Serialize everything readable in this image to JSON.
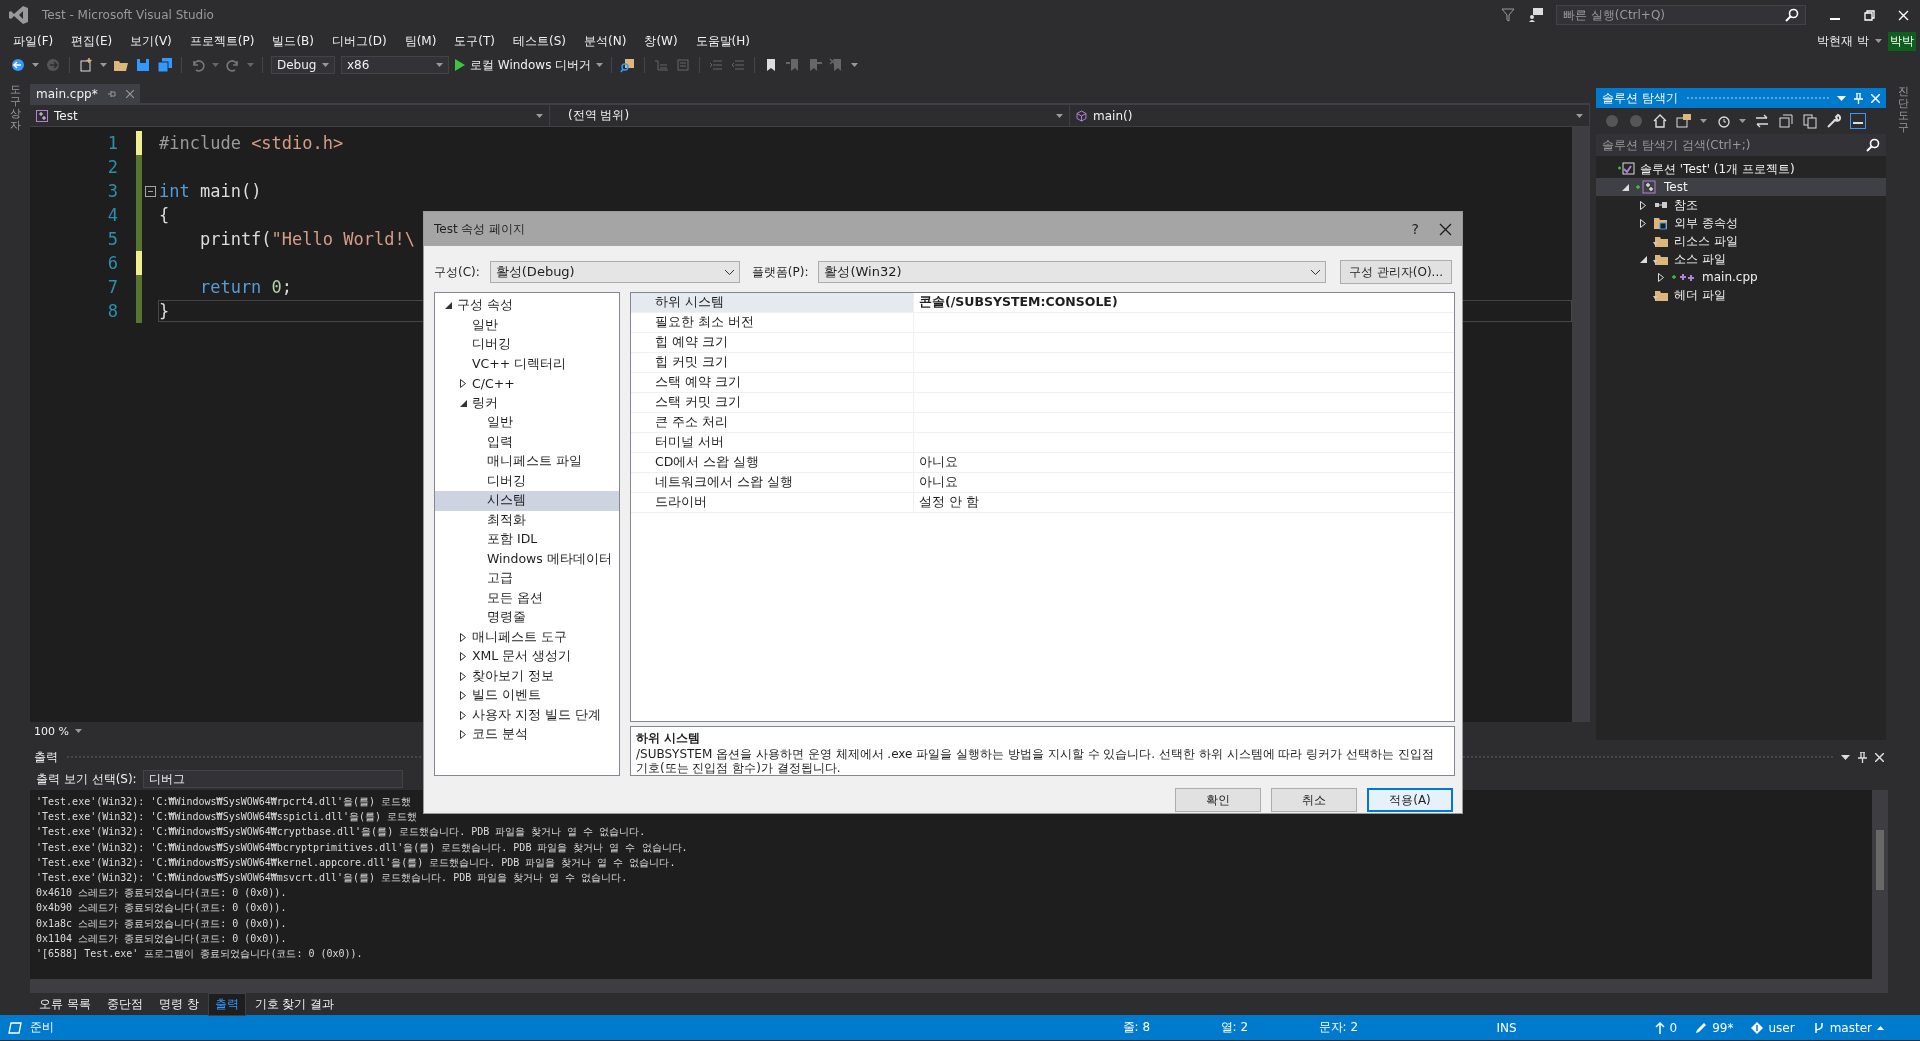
{
  "window": {
    "title": "Test - Microsoft Visual Studio"
  },
  "quick_launch": {
    "placeholder": "빠른 실행(Ctrl+Q)"
  },
  "menu": [
    "파일(F)",
    "편집(E)",
    "보기(V)",
    "프로젝트(P)",
    "빌드(B)",
    "디버그(D)",
    "팀(M)",
    "도구(T)",
    "테스트(S)",
    "분석(N)",
    "창(W)",
    "도움말(H)"
  ],
  "account": {
    "name": "박현재 박",
    "badge": "박박"
  },
  "toolbar": {
    "configuration": "Debug",
    "platform": "x86",
    "run": "로컬 Windows 디버거"
  },
  "left_strip": {
    "label": "도구 상자"
  },
  "right_strip": {
    "label": "진단 도구"
  },
  "editor": {
    "tab": {
      "label": "main.cpp*"
    },
    "nav": {
      "project": "Test",
      "scope": "(전역 범위)",
      "member": "main()"
    },
    "lines": [
      {
        "number": "1",
        "unsaved": true,
        "fold": false,
        "current": false,
        "tokens": [
          {
            "kind": "directive",
            "text": "#include"
          },
          {
            "kind": "string",
            "text": " <stdio.h>"
          }
        ]
      },
      {
        "number": "2",
        "unsaved": false,
        "fold": false,
        "current": false
      },
      {
        "number": "3",
        "unsaved": false,
        "fold": true,
        "current": false,
        "tokens": [
          {
            "kind": "keyword",
            "text": "int"
          },
          {
            "kind": "plain",
            "text": " main()"
          }
        ]
      },
      {
        "number": "4",
        "unsaved": false,
        "fold": false,
        "current": false,
        "tokens": [
          {
            "kind": "plain",
            "text": "{"
          }
        ]
      },
      {
        "number": "5",
        "unsaved": false,
        "fold": false,
        "current": false,
        "tokens": [
          {
            "kind": "plain",
            "text": "    printf("
          },
          {
            "kind": "string",
            "text": "\"Hello World!\\"
          }
        ]
      },
      {
        "number": "6",
        "unsaved": true,
        "fold": false,
        "current": false
      },
      {
        "number": "7",
        "unsaved": false,
        "fold": false,
        "current": false,
        "tokens": [
          {
            "kind": "keyword",
            "text": "    return"
          },
          {
            "kind": "number",
            "text": " 0"
          },
          {
            "kind": "plain",
            "text": ";"
          }
        ]
      },
      {
        "number": "8",
        "unsaved": false,
        "fold": false,
        "current": true,
        "tokens": [
          {
            "kind": "plain",
            "text": "}"
          }
        ]
      }
    ],
    "zoom": "100 %"
  },
  "solution_explorer": {
    "title": "솔루션 탐색기",
    "search": {
      "placeholder": "솔루션 탐색기 검색(Ctrl+;)"
    },
    "tree": [
      {
        "label": "솔루션 'Test' (1개 프로젝트)",
        "kind": "solution",
        "selected": false,
        "children": [
          {
            "label": "Test",
            "kind": "project",
            "expanded": true,
            "selected": true,
            "children": [
              {
                "label": "참조",
                "kind": "references",
                "expanded": false,
                "selected": false
              },
              {
                "label": "외부 종속성",
                "kind": "external",
                "expanded": false,
                "selected": false
              },
              {
                "label": "리소스 파일",
                "kind": "filter",
                "selected": false
              },
              {
                "label": "소스 파일",
                "kind": "filter",
                "expanded": true,
                "selected": false,
                "children": [
                  {
                    "label": "main.cpp",
                    "kind": "cpp",
                    "expanded": false,
                    "selected": false
                  }
                ]
              },
              {
                "label": "헤더 파일",
                "kind": "filter",
                "selected": false
              }
            ]
          }
        ]
      }
    ]
  },
  "output": {
    "title": "출력",
    "source_label": "출력 보기 선택(S):",
    "source": "디버그",
    "lines": [
      "'Test.exe'(Win32): 'C:₩Windows₩SysWOW64₩rpcrt4.dll'을(를) 로드했",
      "'Test.exe'(Win32): 'C:₩Windows₩SysWOW64₩sspicli.dll'을(를) 로드했",
      "'Test.exe'(Win32): 'C:₩Windows₩SysWOW64₩cryptbase.dll'을(를) 로드했습니다. PDB 파일을 찾거나 열 수 없습니다.",
      "'Test.exe'(Win32): 'C:₩Windows₩SysWOW64₩bcryptprimitives.dll'을(를) 로드했습니다. PDB 파일을 찾거나 열 수 없습니다.",
      "'Test.exe'(Win32): 'C:₩Windows₩SysWOW64₩kernel.appcore.dll'을(를) 로드했습니다. PDB 파일을 찾거나 열 수 없습니다.",
      "'Test.exe'(Win32): 'C:₩Windows₩SysWOW64₩msvcrt.dll'을(를) 로드했습니다. PDB 파일을 찾거나 열 수 없습니다.",
      "0x4610 스레드가 종료되었습니다(코드: 0 (0x0)).",
      "0x4b90 스레드가 종료되었습니다(코드: 0 (0x0)).",
      "0x1a8c 스레드가 종료되었습니다(코드: 0 (0x0)).",
      "0x1104 스레드가 종료되었습니다(코드: 0 (0x0)).",
      "'[6588] Test.exe' 프로그램이 종료되었습니다(코드: 0 (0x0))."
    ]
  },
  "bottom_tabs": [
    {
      "label": "오류 목록",
      "selected": false
    },
    {
      "label": "중단점",
      "selected": false
    },
    {
      "label": "명령 창",
      "selected": false
    },
    {
      "label": "출력",
      "selected": true
    },
    {
      "label": "기호 찾기 결과",
      "selected": false
    }
  ],
  "status_bar": {
    "state": "준비",
    "line": "줄: 8",
    "column": "열: 2",
    "char": "문자: 2",
    "mode": "INS",
    "up": "0",
    "pending": "99*",
    "user": "user",
    "branch": "master"
  },
  "dialog": {
    "title": "Test 속성 페이지",
    "help": "?",
    "config_label": "구성(C):",
    "config": "활성(Debug)",
    "platform_label": "플랫폼(P):",
    "platform": "활성(Win32)",
    "manager": "구성 관리자(O)...",
    "tree": [
      {
        "label": "구성 속성",
        "expanded": true,
        "selected": false,
        "children": [
          {
            "label": "일반",
            "selected": false
          },
          {
            "label": "디버깅",
            "selected": false
          },
          {
            "label": "VC++ 디렉터리",
            "selected": false
          },
          {
            "label": "C/C++",
            "expanded": false,
            "selected": false
          },
          {
            "label": "링커",
            "expanded": true,
            "selected": false,
            "children": [
              {
                "label": "일반",
                "selected": false
              },
              {
                "label": "입력",
                "selected": false
              },
              {
                "label": "매니페스트 파일",
                "selected": false
              },
              {
                "label": "디버깅",
                "selected": false
              },
              {
                "label": "시스템",
                "selected": true
              },
              {
                "label": "최적화",
                "selected": false
              },
              {
                "label": "포함 IDL",
                "selected": false
              },
              {
                "label": "Windows 메타데이터",
                "selected": false
              },
              {
                "label": "고급",
                "selected": false
              },
              {
                "label": "모든 옵션",
                "selected": false
              },
              {
                "label": "명령줄",
                "selected": false
              }
            ]
          },
          {
            "label": "매니페스트 도구",
            "expanded": false,
            "selected": false
          },
          {
            "label": "XML 문서 생성기",
            "expanded": false,
            "selected": false
          },
          {
            "label": "찾아보기 정보",
            "expanded": false,
            "selected": false
          },
          {
            "label": "빌드 이벤트",
            "expanded": false,
            "selected": false
          },
          {
            "label": "사용자 지정 빌드 단계",
            "expanded": false,
            "selected": false
          },
          {
            "label": "코드 분석",
            "expanded": false,
            "selected": false
          }
        ]
      }
    ],
    "properties": [
      {
        "name": "하위 시스템",
        "value": "콘솔(/SUBSYSTEM:CONSOLE)",
        "selected": true,
        "modified": true
      },
      {
        "name": "필요한 최소 버전",
        "selected": false
      },
      {
        "name": "힙 예약 크기",
        "selected": false
      },
      {
        "name": "힙 커밋 크기",
        "selected": false
      },
      {
        "name": "스택 예약 크기",
        "selected": false
      },
      {
        "name": "스택 커밋 크기",
        "selected": false
      },
      {
        "name": "큰 주소 처리",
        "selected": false
      },
      {
        "name": "터미널 서버",
        "selected": false
      },
      {
        "name": "CD에서 스왑 실행",
        "value": "아니요",
        "selected": false,
        "modified": false
      },
      {
        "name": "네트워크에서 스왑 실행",
        "value": "아니요",
        "selected": false,
        "modified": false
      },
      {
        "name": "드라이버",
        "value": "설정 안 함",
        "selected": false,
        "modified": false
      }
    ],
    "description": {
      "title": "하위 시스템",
      "text": "/SUBSYSTEM 옵션을 사용하면 운영 체제에서 .exe 파일을 실행하는 방법을 지시할 수 있습니다. 선택한 하위 시스템에 따라 링커가 선택하는 진입점 기호(또는 진입점 함수)가 결정됩니다."
    },
    "buttons": [
      {
        "label": "확인",
        "default": false
      },
      {
        "label": "취소",
        "default": false
      },
      {
        "label": "적용(A)",
        "default": true
      }
    ]
  }
}
